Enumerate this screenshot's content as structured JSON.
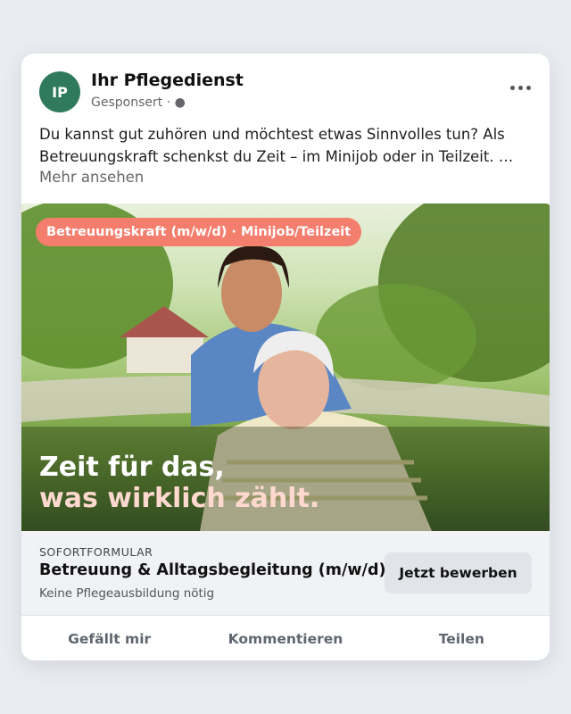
{
  "post": {
    "avatar_initials": "IP",
    "page_name": "Ihr Pflegedienst",
    "sponsored_label": "Gesponsert · ●",
    "text": "Du kannst gut zuhören und möchtest etwas Sinnvolles tun? Als Betreuungskraft schenkst du Zeit – im Minijob oder in Teilzeit. …",
    "see_more": "Mehr ansehen",
    "more_icon": "more-horizontal-icon"
  },
  "image": {
    "tag": "Betreuungskraft (m/w/d) · Minijob/Teilzeit",
    "headline_line1": "Zeit für das,",
    "headline_line2": "was wirklich zählt."
  },
  "cta": {
    "form_label": "SOFORTFORMULAR",
    "title": "Betreuung & Alltagsbegleitung (m/w/d)",
    "subtitle": "Keine Pflegeausbildung nötig",
    "button": "Jetzt bewerben"
  },
  "actions": {
    "like": "Gefällt mir",
    "comment": "Kommentieren",
    "share": "Teilen"
  },
  "colors": {
    "avatar": "#2f7a5c",
    "tag": "#f47e6e",
    "headline_accent": "#ffd9cf"
  }
}
